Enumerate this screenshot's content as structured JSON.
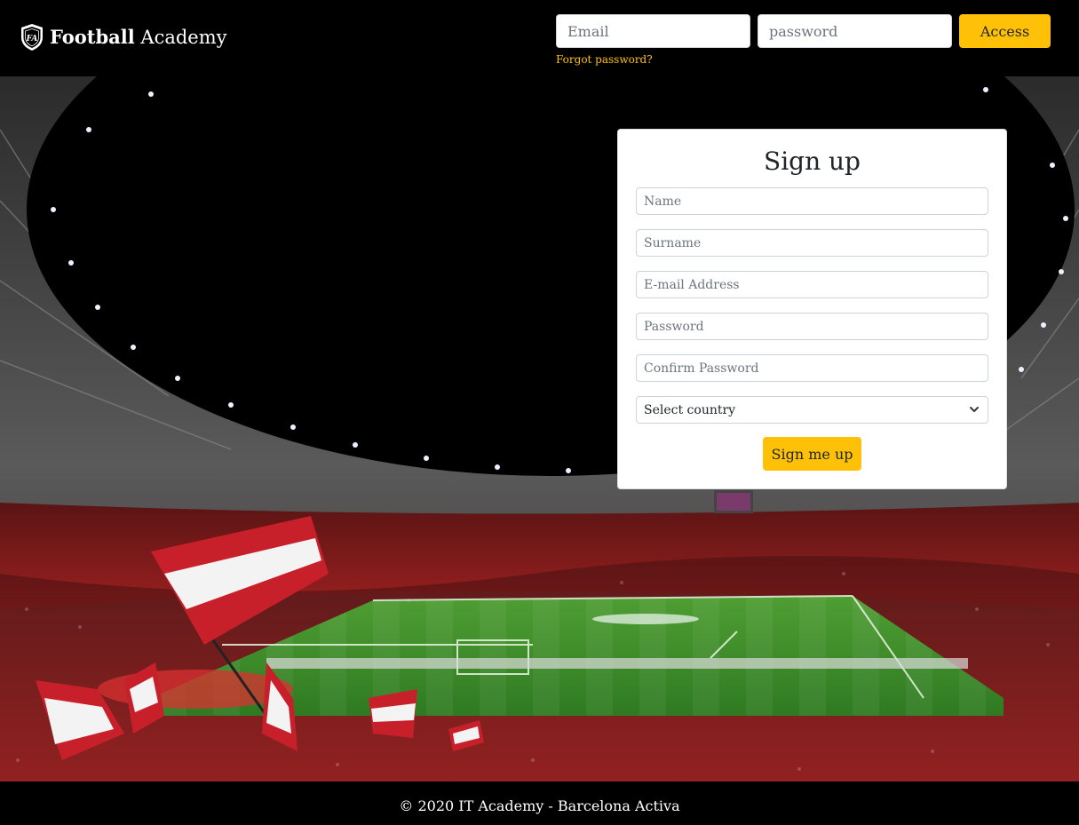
{
  "brand": {
    "bold": "Football",
    "light": " Academy",
    "logo_text": "FA"
  },
  "login": {
    "email_placeholder": "Email",
    "password_placeholder": "password",
    "access_label": "Access",
    "forgot_label": "Forgot password?"
  },
  "signup": {
    "title": "Sign up",
    "name_placeholder": "Name",
    "surname_placeholder": "Surname",
    "email_placeholder": "E-mail Address",
    "password_placeholder": "Password",
    "confirm_placeholder": "Confirm Password",
    "country_selected": "Select country",
    "submit_label": "Sign me up"
  },
  "footer": {
    "text": "© 2020 IT Academy - Barcelona Activa"
  },
  "colors": {
    "accent": "#ffc107",
    "header_bg": "#000000",
    "pitch": "#3f8f2a",
    "crowd": "#8b1a1a"
  }
}
